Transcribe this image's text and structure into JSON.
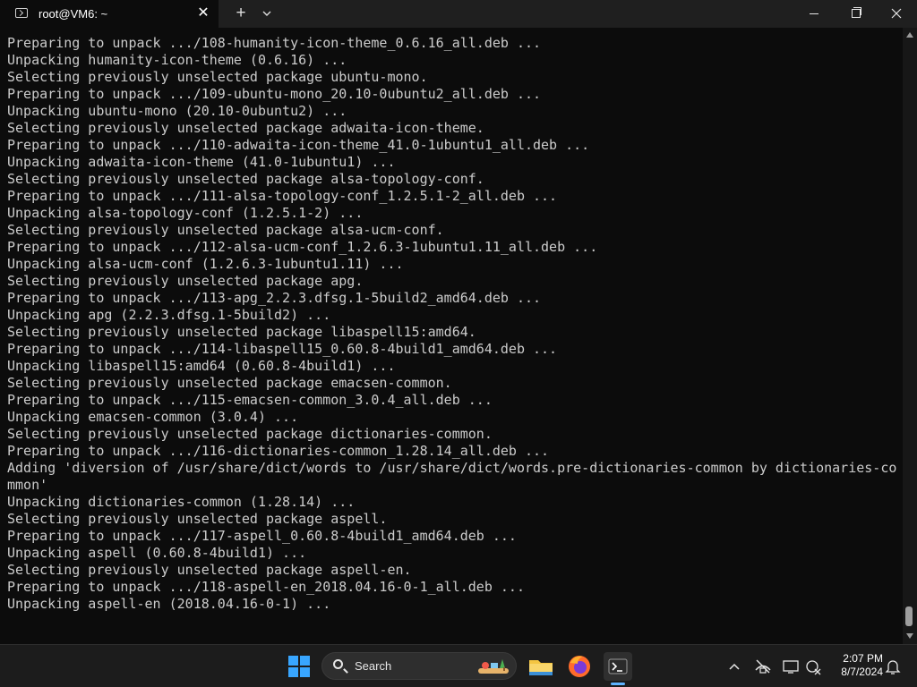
{
  "window": {
    "tab_title": "root@VM6: ~",
    "tab_close_glyph": "✕",
    "new_tab_glyph": "+"
  },
  "terminal": {
    "lines": [
      "Preparing to unpack .../108-humanity-icon-theme_0.6.16_all.deb ...",
      "Unpacking humanity-icon-theme (0.6.16) ...",
      "Selecting previously unselected package ubuntu-mono.",
      "Preparing to unpack .../109-ubuntu-mono_20.10-0ubuntu2_all.deb ...",
      "Unpacking ubuntu-mono (20.10-0ubuntu2) ...",
      "Selecting previously unselected package adwaita-icon-theme.",
      "Preparing to unpack .../110-adwaita-icon-theme_41.0-1ubuntu1_all.deb ...",
      "Unpacking adwaita-icon-theme (41.0-1ubuntu1) ...",
      "Selecting previously unselected package alsa-topology-conf.",
      "Preparing to unpack .../111-alsa-topology-conf_1.2.5.1-2_all.deb ...",
      "Unpacking alsa-topology-conf (1.2.5.1-2) ...",
      "Selecting previously unselected package alsa-ucm-conf.",
      "Preparing to unpack .../112-alsa-ucm-conf_1.2.6.3-1ubuntu1.11_all.deb ...",
      "Unpacking alsa-ucm-conf (1.2.6.3-1ubuntu1.11) ...",
      "Selecting previously unselected package apg.",
      "Preparing to unpack .../113-apg_2.2.3.dfsg.1-5build2_amd64.deb ...",
      "Unpacking apg (2.2.3.dfsg.1-5build2) ...",
      "Selecting previously unselected package libaspell15:amd64.",
      "Preparing to unpack .../114-libaspell15_0.60.8-4build1_amd64.deb ...",
      "Unpacking libaspell15:amd64 (0.60.8-4build1) ...",
      "Selecting previously unselected package emacsen-common.",
      "Preparing to unpack .../115-emacsen-common_3.0.4_all.deb ...",
      "Unpacking emacsen-common (3.0.4) ...",
      "Selecting previously unselected package dictionaries-common.",
      "Preparing to unpack .../116-dictionaries-common_1.28.14_all.deb ...",
      "Adding 'diversion of /usr/share/dict/words to /usr/share/dict/words.pre-dictionaries-common by dictionaries-co",
      "mmon'",
      "Unpacking dictionaries-common (1.28.14) ...",
      "Selecting previously unselected package aspell.",
      "Preparing to unpack .../117-aspell_0.60.8-4build1_amd64.deb ...",
      "Unpacking aspell (0.60.8-4build1) ...",
      "Selecting previously unselected package aspell-en.",
      "Preparing to unpack .../118-aspell-en_2018.04.16-0-1_all.deb ...",
      "Unpacking aspell-en (2018.04.16-0-1) ..."
    ]
  },
  "taskbar": {
    "search_label": "Search",
    "clock_time": "2:07 PM",
    "clock_date": "8/7/2024",
    "icons": [
      "start-icon",
      "search-icon",
      "file-explorer-icon",
      "firefox-icon",
      "terminal-icon",
      "chevron-up-icon",
      "network-off-icon",
      "display-icon",
      "battery-icon",
      "notification-bell-icon"
    ]
  },
  "colors": {
    "terminal_bg": "#0c0c0c",
    "terminal_text": "#cccccc",
    "taskbar_bg": "#1c1c1c",
    "accent": "#5eb3ff"
  }
}
